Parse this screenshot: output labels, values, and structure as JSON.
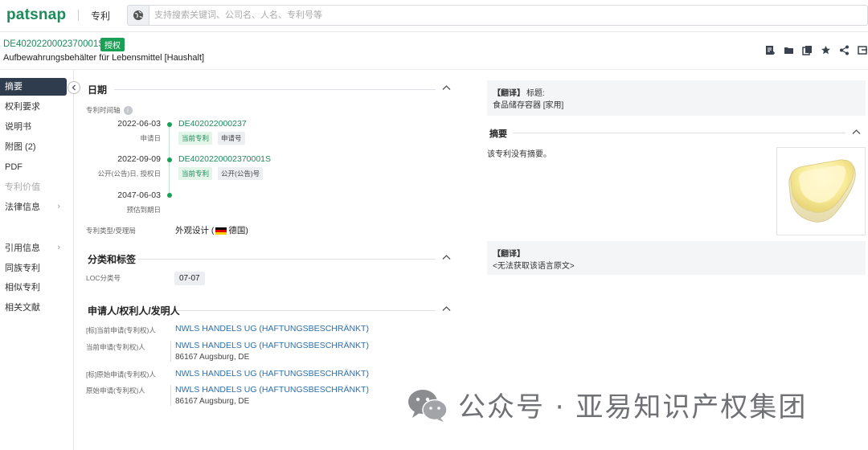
{
  "topbar": {
    "logo": "patsnap",
    "module": "专利",
    "search_placeholder": "支持搜索关键词、公司名、人名、专利号等"
  },
  "patent": {
    "number": "DE4020220002370001S",
    "status": "授权",
    "title": "Aufbewahrungsbehälter für Lebensmittel [Haushalt]"
  },
  "toolbar": {
    "icons": [
      "add-note-icon",
      "folder-icon",
      "copy-icon",
      "star-icon",
      "share-icon",
      "export-icon"
    ]
  },
  "sidebar": {
    "items": [
      {
        "label": "摘要"
      },
      {
        "label": "权利要求"
      },
      {
        "label": "说明书"
      },
      {
        "label": "附图 (2)"
      },
      {
        "label": "PDF"
      },
      {
        "label": "专利价值"
      },
      {
        "label": "法律信息"
      },
      {
        "label": "引用信息"
      },
      {
        "label": "同族专利"
      },
      {
        "label": "相似专利"
      },
      {
        "label": "相关文献"
      }
    ]
  },
  "dates": {
    "title": "日期",
    "timeline_label": "专利时间轴",
    "events": [
      {
        "date": "2022-06-03",
        "type": "申请日",
        "number": "DE402022000237",
        "tags": [
          "当前专利",
          "申请号"
        ]
      },
      {
        "date": "2022-09-09",
        "type": "公开(公告)日, 授权日",
        "number": "DE4020220002370001S",
        "tags": [
          "当前专利",
          "公开(公告)号"
        ]
      },
      {
        "date": "2047-06-03",
        "type": "预估到期日",
        "number": "",
        "tags": []
      }
    ],
    "kind_label": "专利类型/受理局",
    "kind_value": "外观设计 (",
    "country": "德国)"
  },
  "classification": {
    "title": "分类和标签",
    "loc_label": "LOC分类号",
    "loc_value": "07-07"
  },
  "parties": {
    "title": "申请人/权利人/发明人",
    "rows": [
      {
        "label": "[标]当前申请(专利权)人",
        "name": "NWLS HANDELS UG (HAFTUNGSBESCHRÄNKT)",
        "address": ""
      },
      {
        "label": "当前申请(专利权)人",
        "name": "NWLS HANDELS UG (HAFTUNGSBESCHRÄNKT)",
        "address": "86167 Augsburg, DE"
      },
      {
        "label": "[标]原始申请(专利权)人",
        "name": "NWLS HANDELS UG (HAFTUNGSBESCHRÄNKT)",
        "address": ""
      },
      {
        "label": "原始申请(专利权)人",
        "name": "NWLS HANDELS UG (HAFTUNGSBESCHRÄNKT)",
        "address": "86167 Augsburg, DE"
      }
    ]
  },
  "right": {
    "translate_label": "【翻译】",
    "title_label": "标题:",
    "translated_title": "食品储存容器 [家用]",
    "abstract_title": "摘要",
    "no_abstract": "该专利没有摘要。",
    "translate_label2": "【翻译】",
    "no_original": "<无法获取该语言原文>"
  },
  "watermark": {
    "text": "公众号 · 亚易知识产权集团"
  },
  "colors": {
    "brand": "#1f8a5c",
    "status_green": "#1aa054",
    "sidebar_active": "#2f3c4d",
    "link_blue": "#2a6fb0"
  }
}
